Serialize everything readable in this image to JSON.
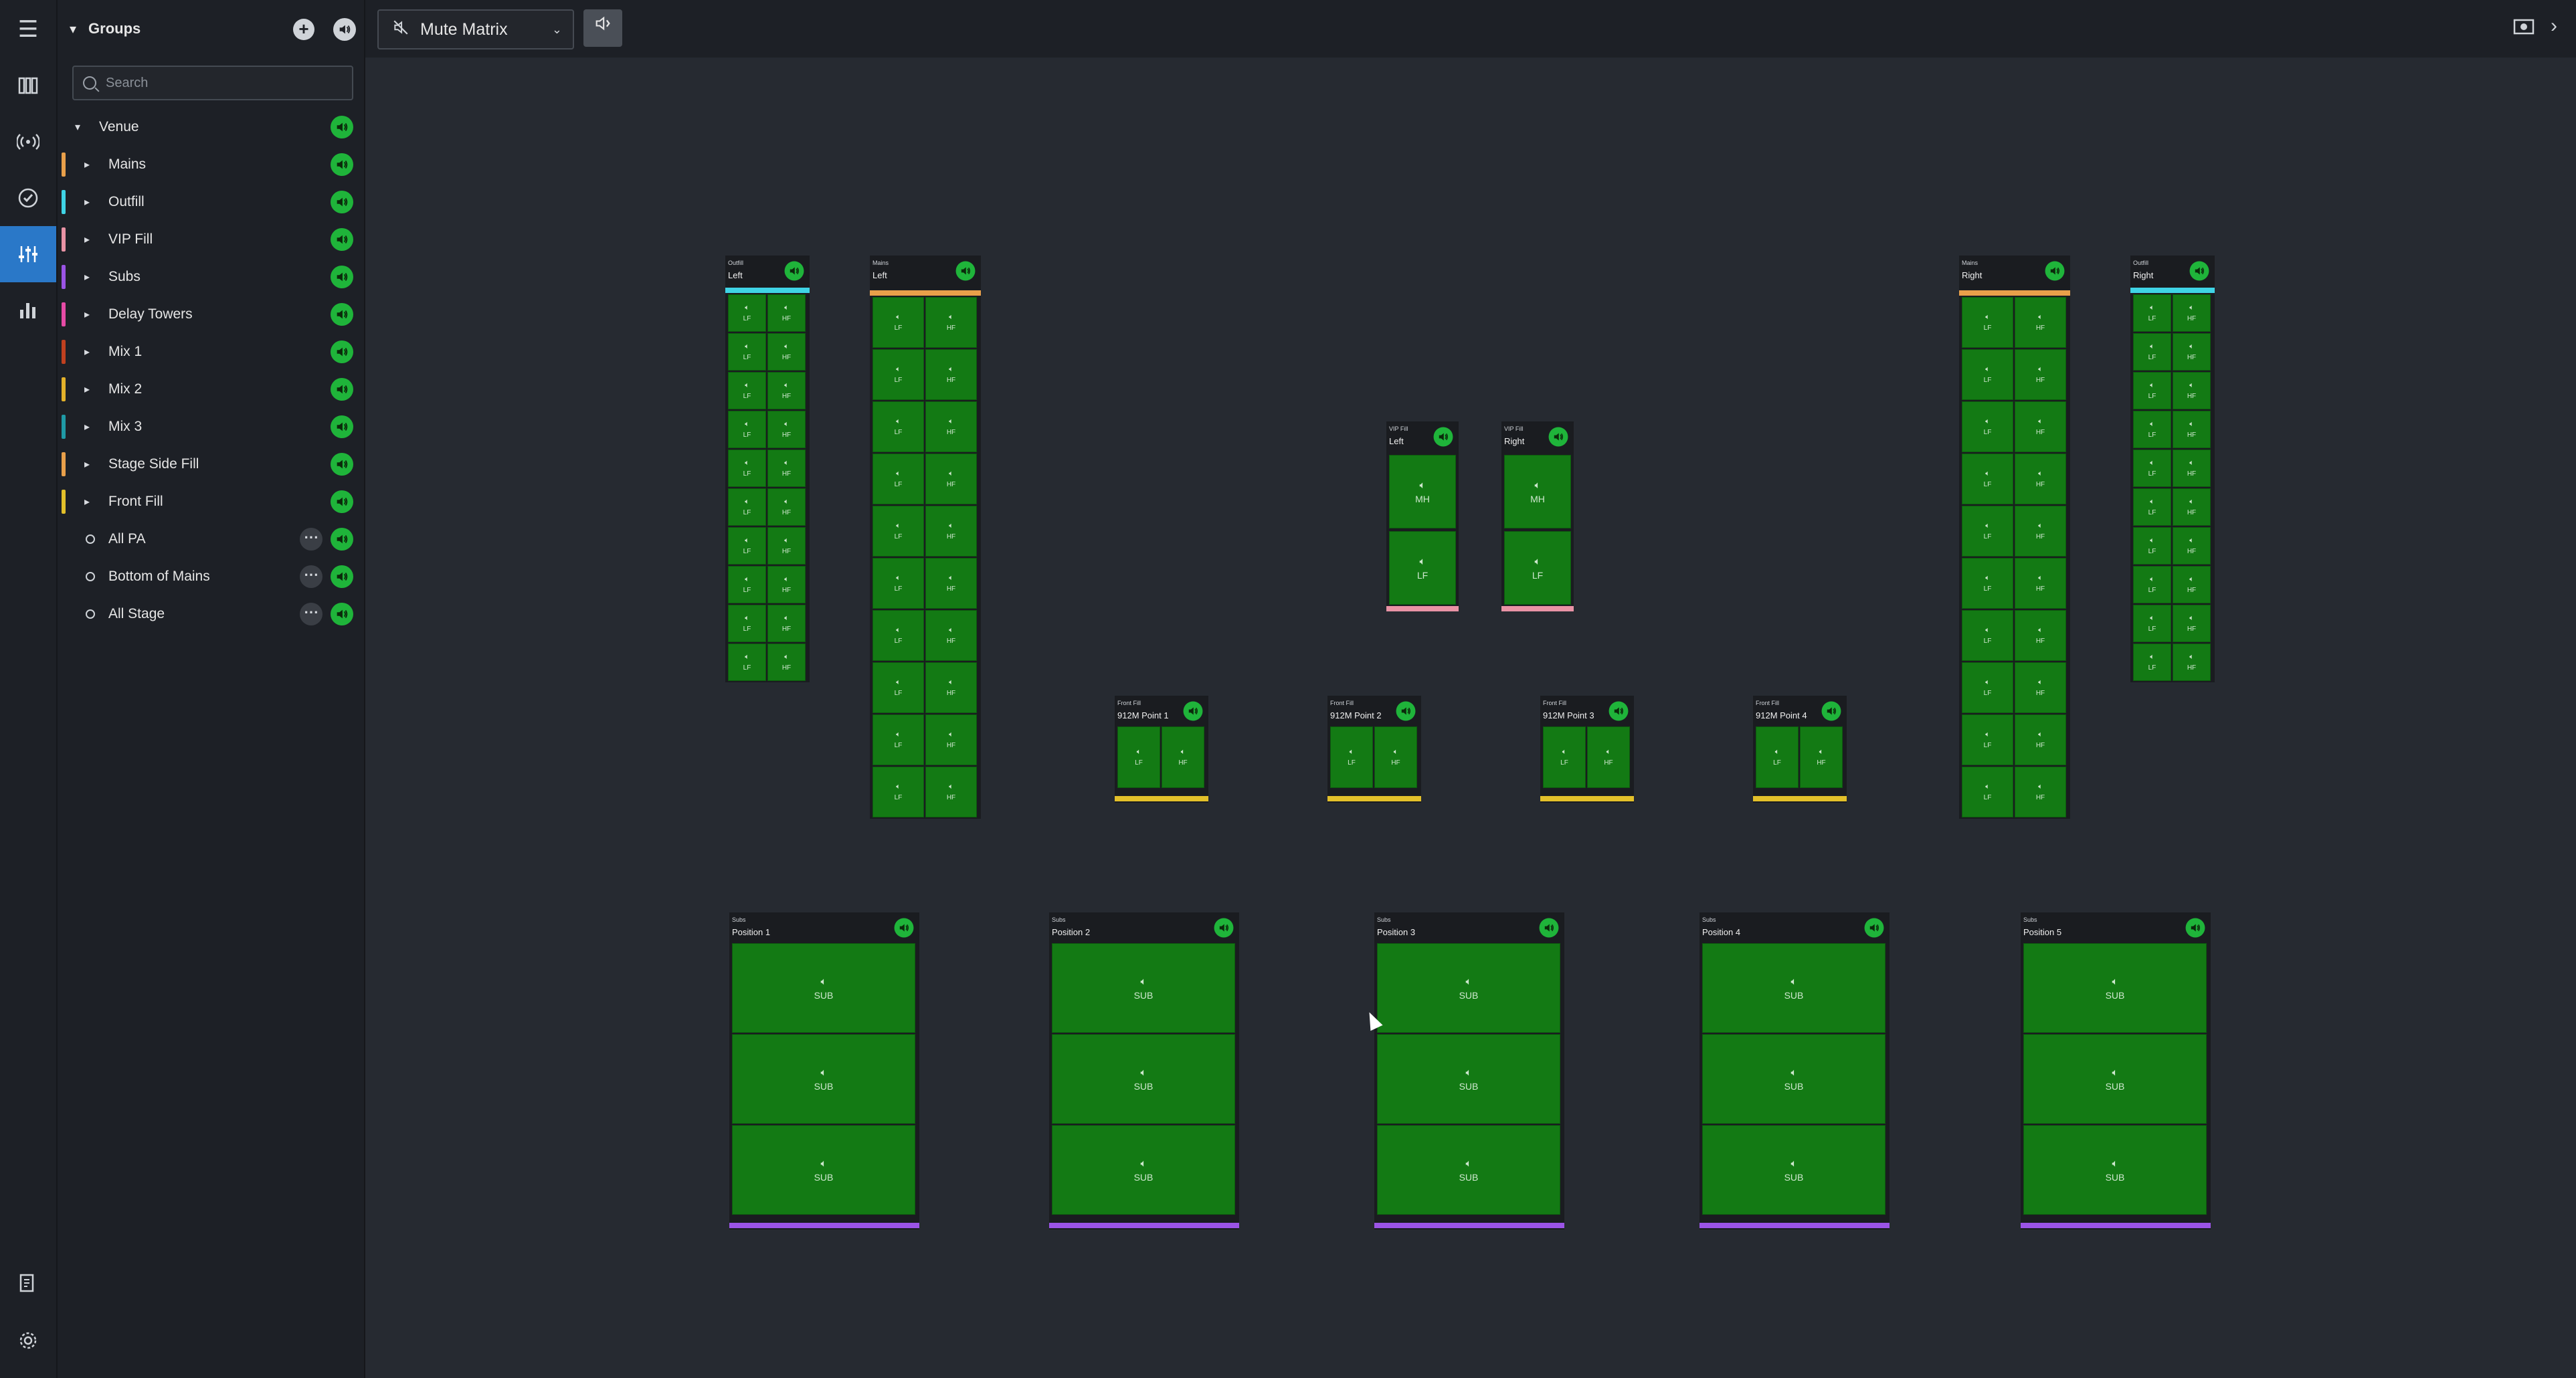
{
  "rail": {
    "items": [
      {
        "name": "menu-icon",
        "glyph": "☰"
      },
      {
        "name": "devices-icon",
        "glyph": "▥"
      },
      {
        "name": "network-icon",
        "glyph": "((•))"
      },
      {
        "name": "check-icon",
        "glyph": "✓"
      },
      {
        "name": "mixer-icon",
        "glyph": "≡"
      },
      {
        "name": "bars-icon",
        "glyph": "▇"
      },
      {
        "name": "notes-icon",
        "glyph": "✎"
      },
      {
        "name": "settings-icon",
        "glyph": "⚙"
      }
    ]
  },
  "panel": {
    "title": "Groups",
    "add": "+",
    "search_placeholder": "Search",
    "tree": [
      {
        "label": "Venue",
        "color": "",
        "type": "root"
      },
      {
        "label": "Mains",
        "color": "#e9a04a",
        "type": "group"
      },
      {
        "label": "Outfill",
        "color": "#3fd4e6",
        "type": "group"
      },
      {
        "label": "VIP Fill",
        "color": "#e993a5",
        "type": "group"
      },
      {
        "label": "Subs",
        "color": "#9b54e6",
        "type": "group"
      },
      {
        "label": "Delay Towers",
        "color": "#e64ba6",
        "type": "group"
      },
      {
        "label": "Mix 1",
        "color": "#c0401f",
        "type": "group"
      },
      {
        "label": "Mix 2",
        "color": "#e3b12a",
        "type": "group"
      },
      {
        "label": "Mix 3",
        "color": "#1f9aa6",
        "type": "group"
      },
      {
        "label": "Stage Side Fill",
        "color": "#e9a04a",
        "type": "group"
      },
      {
        "label": "Front Fill",
        "color": "#e3c02a",
        "type": "group"
      },
      {
        "label": "All PA",
        "color": "",
        "type": "custom"
      },
      {
        "label": "Bottom of Mains",
        "color": "",
        "type": "custom"
      },
      {
        "label": "All Stage",
        "color": "",
        "type": "custom"
      }
    ]
  },
  "topbar": {
    "mode": "Mute Matrix",
    "dropdown": "⌄"
  },
  "colors": {
    "green": "#137a14",
    "outfill": "#3fd4e6",
    "mains": "#e9a04a",
    "vip": "#e993a5",
    "front": "#e3c02a",
    "subs": "#9b54e6"
  },
  "blocks": [
    {
      "group": "Outfill",
      "name": "Left",
      "strip": "outfill",
      "cols": [
        "LF",
        "HF"
      ],
      "rows": 10
    },
    {
      "group": "Mains",
      "name": "Left",
      "strip": "mains",
      "cols": [
        "LF",
        "HF"
      ],
      "rows": 10
    },
    {
      "group": "VIP Fill",
      "name": "Left",
      "strip": "vip",
      "cols": [
        "MH",
        "LF"
      ],
      "vertical": true
    },
    {
      "group": "VIP Fill",
      "name": "Right",
      "strip": "vip",
      "cols": [
        "MH",
        "LF"
      ],
      "vertical": true
    },
    {
      "group": "Mains",
      "name": "Right",
      "strip": "mains",
      "cols": [
        "LF",
        "HF"
      ],
      "rows": 10
    },
    {
      "group": "Outfill",
      "name": "Right",
      "strip": "outfill",
      "cols": [
        "LF",
        "HF"
      ],
      "rows": 10
    },
    {
      "group": "Front Fill",
      "name": "912M Point 1",
      "strip": "front",
      "cols": [
        "LF",
        "HF"
      ],
      "rows": 1
    },
    {
      "group": "Front Fill",
      "name": "912M Point 2",
      "strip": "front",
      "cols": [
        "LF",
        "HF"
      ],
      "rows": 1
    },
    {
      "group": "Front Fill",
      "name": "912M Point 3",
      "strip": "front",
      "cols": [
        "LF",
        "HF"
      ],
      "rows": 1
    },
    {
      "group": "Front Fill",
      "name": "912M Point 4",
      "strip": "front",
      "cols": [
        "LF",
        "HF"
      ],
      "rows": 1
    },
    {
      "group": "Subs",
      "name": "Position 1",
      "strip": "subs",
      "cols": [
        "SUB"
      ],
      "rows": 3
    },
    {
      "group": "Subs",
      "name": "Position 2",
      "strip": "subs",
      "cols": [
        "SUB"
      ],
      "rows": 3
    },
    {
      "group": "Subs",
      "name": "Position 3",
      "strip": "subs",
      "cols": [
        "SUB"
      ],
      "rows": 3
    },
    {
      "group": "Subs",
      "name": "Position 4",
      "strip": "subs",
      "cols": [
        "SUB"
      ],
      "rows": 3
    },
    {
      "group": "Subs",
      "name": "Position 5",
      "strip": "subs",
      "cols": [
        "SUB"
      ],
      "rows": 3
    }
  ]
}
